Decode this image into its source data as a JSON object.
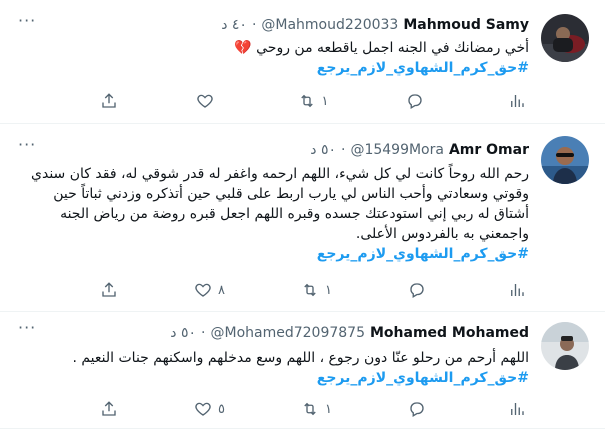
{
  "tweets": [
    {
      "name": "Mahmoud Samy",
      "handle": "@Mahmoud220033",
      "time": "٤٠ د",
      "dot": "·",
      "text": "أخي رمضانك في الجنه اجمل ياقطعه من روحي",
      "emoji": "💔",
      "hashtag": "#حق_كرم_الشهاوي_لازم_يرجع",
      "replies": "",
      "retweets": "١",
      "likes": "",
      "views": ""
    },
    {
      "name": "Amr Omar",
      "handle": "@15499Mora",
      "time": "٥٠ د",
      "dot": "·",
      "text": "رحم الله روحاً كانت لي كل شيء، اللهم ارحمه واغفر له قدر شوقي له، فقد كان سندي وقوتي وسعادتي وأحب الناس لي يارب اربط على قلبي حين أتذكره وزدني ثباتاً حين أشتاق له ربي إني استودعتك جسده وقبره اللهم اجعل قبره روضة من رياض الجنه واجمعني به بالفردوس الأعلى.",
      "hashtag": "#حق_كرم_الشهاوي_لازم_يرجع",
      "replies": "",
      "retweets": "١",
      "likes": "٨",
      "views": ""
    },
    {
      "name": "Mohamed Mohamed",
      "handle": "@Mohamed72097875",
      "time": "٥٠ د",
      "dot": "·",
      "text": "اللهم أرحم من رحلو عنّا دون رجوع ، اللهم وسع مدخلهم واسكنهم جنات النعيم .",
      "hashtag": "#حق_كرم_الشهاوي_لازم_يرجع",
      "replies": "",
      "retweets": "١",
      "likes": "٥",
      "views": ""
    }
  ],
  "more_label": "···",
  "colors": {
    "link": "#1d9bf0",
    "muted": "#536471",
    "text": "#0f1419"
  },
  "icons": [
    "share-icon",
    "like-icon",
    "retweet-icon",
    "reply-icon",
    "views-icon",
    "more-icon"
  ]
}
